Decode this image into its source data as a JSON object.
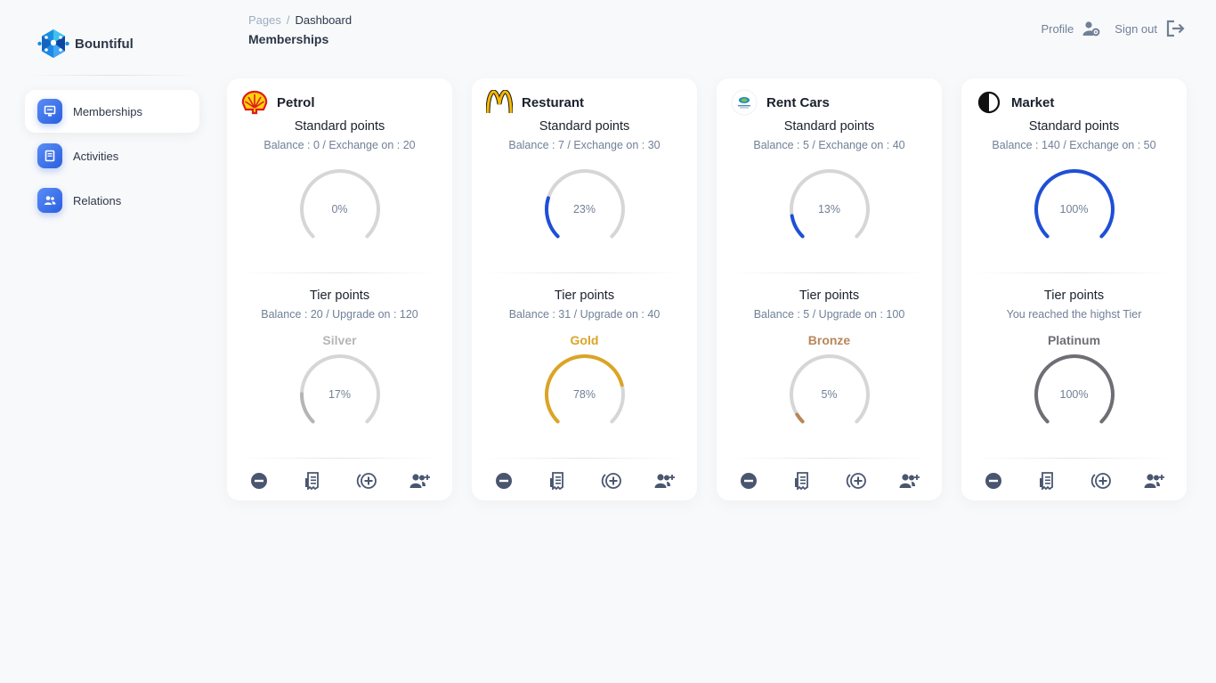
{
  "brand": {
    "name": "Bountiful",
    "icon": "hex-network-logo"
  },
  "sidebar": {
    "items": [
      {
        "label": "Memberships",
        "icon": "monitor-icon",
        "active": true
      },
      {
        "label": "Activities",
        "icon": "receipt-icon",
        "active": false
      },
      {
        "label": "Relations",
        "icon": "users-icon",
        "active": false
      }
    ]
  },
  "header": {
    "breadcrumb_root": "Pages",
    "breadcrumb_sep": "/",
    "breadcrumb_current": "Dashboard",
    "title": "Memberships",
    "profile_label": "Profile",
    "signout_label": "Sign out"
  },
  "colors": {
    "accent": "#1f4fd6",
    "track": "#d6d6d6",
    "silver": "#b5b5b5",
    "gold": "#dca424",
    "bronze": "#b8875a",
    "platinum": "#6e6e75",
    "action_icon": "#4a5670"
  },
  "memberships": [
    {
      "name": "Petrol",
      "logo": "shell-logo",
      "standard_title": "Standard points",
      "standard_sub": "Balance : 0 / Exchange on : 20",
      "standard_pct": 0,
      "standard_label": "0%",
      "tier_title": "Tier points",
      "tier_sub": "Balance : 20 / Upgrade on : 120",
      "tier_name": "Silver",
      "tier_color": "#b5b5b5",
      "tier_pct": 17,
      "tier_label": "17%"
    },
    {
      "name": "Resturant",
      "logo": "golden-arches-logo",
      "standard_title": "Standard points",
      "standard_sub": "Balance : 7 / Exchange on : 30",
      "standard_pct": 23,
      "standard_label": "23%",
      "tier_title": "Tier points",
      "tier_sub": "Balance : 31 / Upgrade on : 40",
      "tier_name": "Gold",
      "tier_color": "#dca424",
      "tier_pct": 78,
      "tier_label": "78%"
    },
    {
      "name": "Rent Cars",
      "logo": "rent-cars-logo",
      "standard_title": "Standard points",
      "standard_sub": "Balance : 5 / Exchange on : 40",
      "standard_pct": 13,
      "standard_label": "13%",
      "tier_title": "Tier points",
      "tier_sub": "Balance : 5 / Upgrade on : 100",
      "tier_name": "Bronze",
      "tier_color": "#b8875a",
      "tier_pct": 5,
      "tier_label": "5%"
    },
    {
      "name": "Market",
      "logo": "half-circle-logo",
      "standard_title": "Standard points",
      "standard_sub": "Balance : 140 / Exchange on : 50",
      "standard_pct": 100,
      "standard_label": "100%",
      "tier_title": "Tier points",
      "tier_sub": "You reached the highst Tier",
      "tier_name": "Platinum",
      "tier_color": "#6e6e75",
      "tier_pct": 100,
      "tier_label": "100%"
    }
  ]
}
